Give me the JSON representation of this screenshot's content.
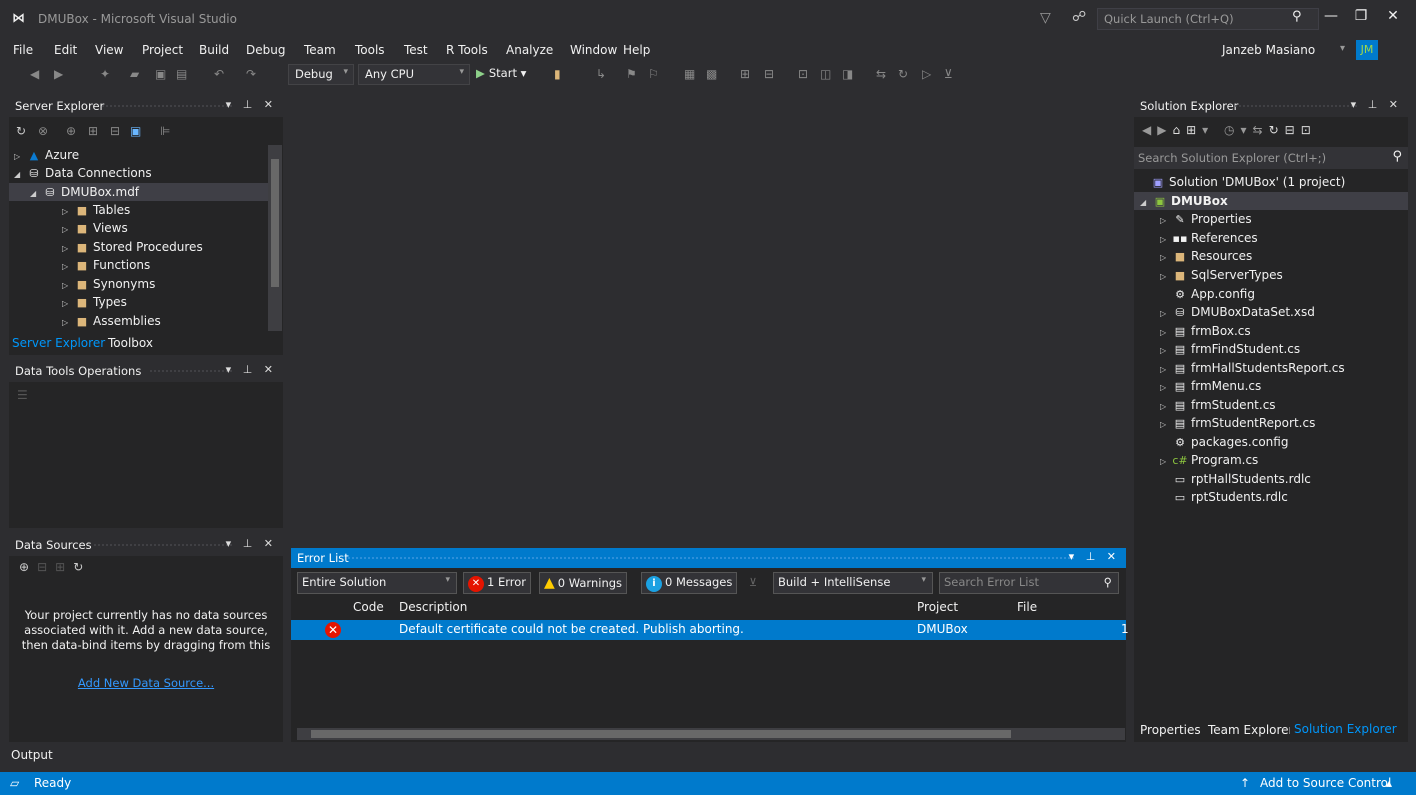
{
  "window": {
    "title": "DMUBox - Microsoft Visual Studio",
    "quick_launch_placeholder": "Quick Launch (Ctrl+Q)",
    "user": "Janzeb Masiano",
    "user_initials": "JM"
  },
  "menu": [
    "File",
    "Edit",
    "View",
    "Project",
    "Build",
    "Debug",
    "Team",
    "Tools",
    "Test",
    "R Tools",
    "Analyze",
    "Window",
    "Help"
  ],
  "toolbar": {
    "config": "Debug",
    "platform": "Any CPU",
    "start_label": "Start"
  },
  "server_explorer": {
    "title": "Server Explorer",
    "items": [
      {
        "label": "Azure"
      },
      {
        "label": "Data Connections"
      },
      {
        "label": "DMUBox.mdf"
      },
      {
        "label": "Tables"
      },
      {
        "label": "Views"
      },
      {
        "label": "Stored Procedures"
      },
      {
        "label": "Functions"
      },
      {
        "label": "Synonyms"
      },
      {
        "label": "Types"
      },
      {
        "label": "Assemblies"
      }
    ],
    "tabs": [
      "Server Explorer",
      "Toolbox"
    ]
  },
  "data_tools": {
    "title": "Data Tools Operations"
  },
  "data_sources": {
    "title": "Data Sources",
    "message": "Your project currently has no data sources associated with it. Add a new data source, then data-bind items by dragging from this",
    "link": "Add New Data Source..."
  },
  "error_list": {
    "title": "Error List",
    "scope": "Entire Solution",
    "errors_label": "1 Error",
    "warnings_label": "0 Warnings",
    "messages_label": "0 Messages",
    "build_filter": "Build + IntelliSense",
    "search_placeholder": "Search Error List",
    "columns": [
      "Code",
      "Description",
      "Project",
      "File"
    ],
    "rows": [
      {
        "code": "",
        "description": "Default certificate could not be created. Publish aborting.",
        "project": "DMUBox",
        "line": "1"
      }
    ]
  },
  "solution_explorer": {
    "title": "Solution Explorer",
    "search_placeholder": "Search Solution Explorer (Ctrl+;)",
    "items": [
      {
        "label": "Solution 'DMUBox' (1 project)"
      },
      {
        "label": "DMUBox"
      },
      {
        "label": "Properties"
      },
      {
        "label": "References"
      },
      {
        "label": "Resources"
      },
      {
        "label": "SqlServerTypes"
      },
      {
        "label": "App.config"
      },
      {
        "label": "DMUBoxDataSet.xsd"
      },
      {
        "label": "frmBox.cs"
      },
      {
        "label": "frmFindStudent.cs"
      },
      {
        "label": "frmHallStudentsReport.cs"
      },
      {
        "label": "frmMenu.cs"
      },
      {
        "label": "frmStudent.cs"
      },
      {
        "label": "frmStudentReport.cs"
      },
      {
        "label": "packages.config"
      },
      {
        "label": "Program.cs"
      },
      {
        "label": "rptHallStudents.rdlc"
      },
      {
        "label": "rptStudents.rdlc"
      }
    ],
    "tabs": [
      "Properties",
      "Team Explorer",
      "Solution Explorer"
    ]
  },
  "output_label": "Output",
  "status": {
    "text": "Ready",
    "source_control": "Add to Source Control"
  }
}
